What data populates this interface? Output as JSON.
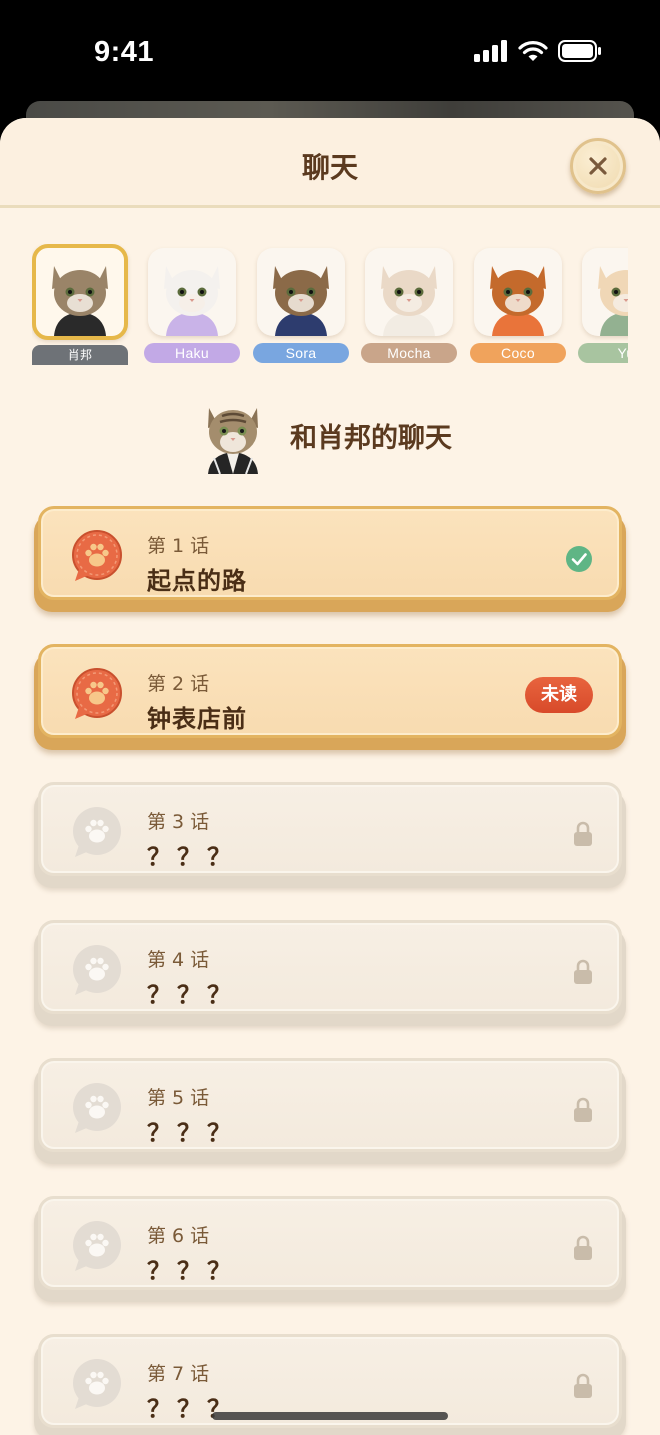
{
  "status_bar": {
    "time": "9:41"
  },
  "header": {
    "title": "聊天"
  },
  "characters": [
    {
      "name": "肖邦",
      "selected": true,
      "label_color": "#6e7277",
      "fur": "#9a8468",
      "shirt": "#2a2a2a"
    },
    {
      "name": "Haku",
      "selected": false,
      "label_color": "#c2a9e6",
      "fur": "#f4f1ee",
      "shirt": "#c9b3e8"
    },
    {
      "name": "Sora",
      "selected": false,
      "label_color": "#79a6e0",
      "fur": "#8b6a48",
      "shirt": "#2d3c6e"
    },
    {
      "name": "Mocha",
      "selected": false,
      "label_color": "#c9a58a",
      "fur": "#ead9c7",
      "shirt": "#f2ece3"
    },
    {
      "name": "Coco",
      "selected": false,
      "label_color": "#f0a35c",
      "fur": "#c46a2c",
      "shirt": "#e9743a"
    },
    {
      "name": "Yu",
      "selected": false,
      "label_color": "#a8c4a0",
      "fur": "#f0d7b6",
      "shirt": "#93b191"
    }
  ],
  "chat": {
    "title": "和肖邦的聊天"
  },
  "episodes": [
    {
      "number": "第 1 话",
      "title": "起点的路",
      "state": "completed"
    },
    {
      "number": "第 2 话",
      "title": "钟表店前",
      "state": "unread",
      "badge": "未读"
    },
    {
      "number": "第 3 话",
      "title": "？？？",
      "state": "locked"
    },
    {
      "number": "第 4 话",
      "title": "？？？",
      "state": "locked"
    },
    {
      "number": "第 5 话",
      "title": "？？？",
      "state": "locked"
    },
    {
      "number": "第 6 话",
      "title": "？？？",
      "state": "locked"
    },
    {
      "number": "第 7 话",
      "title": "？？？",
      "state": "locked"
    }
  ],
  "colors": {
    "accent": "#e3b461",
    "unread": "#d84a2a",
    "check": "#5fb585",
    "text": "#4a2e16"
  },
  "icons": {
    "close": "close-icon",
    "paw": "paw-bubble-icon",
    "check": "check-circle-icon",
    "lock": "lock-icon"
  }
}
